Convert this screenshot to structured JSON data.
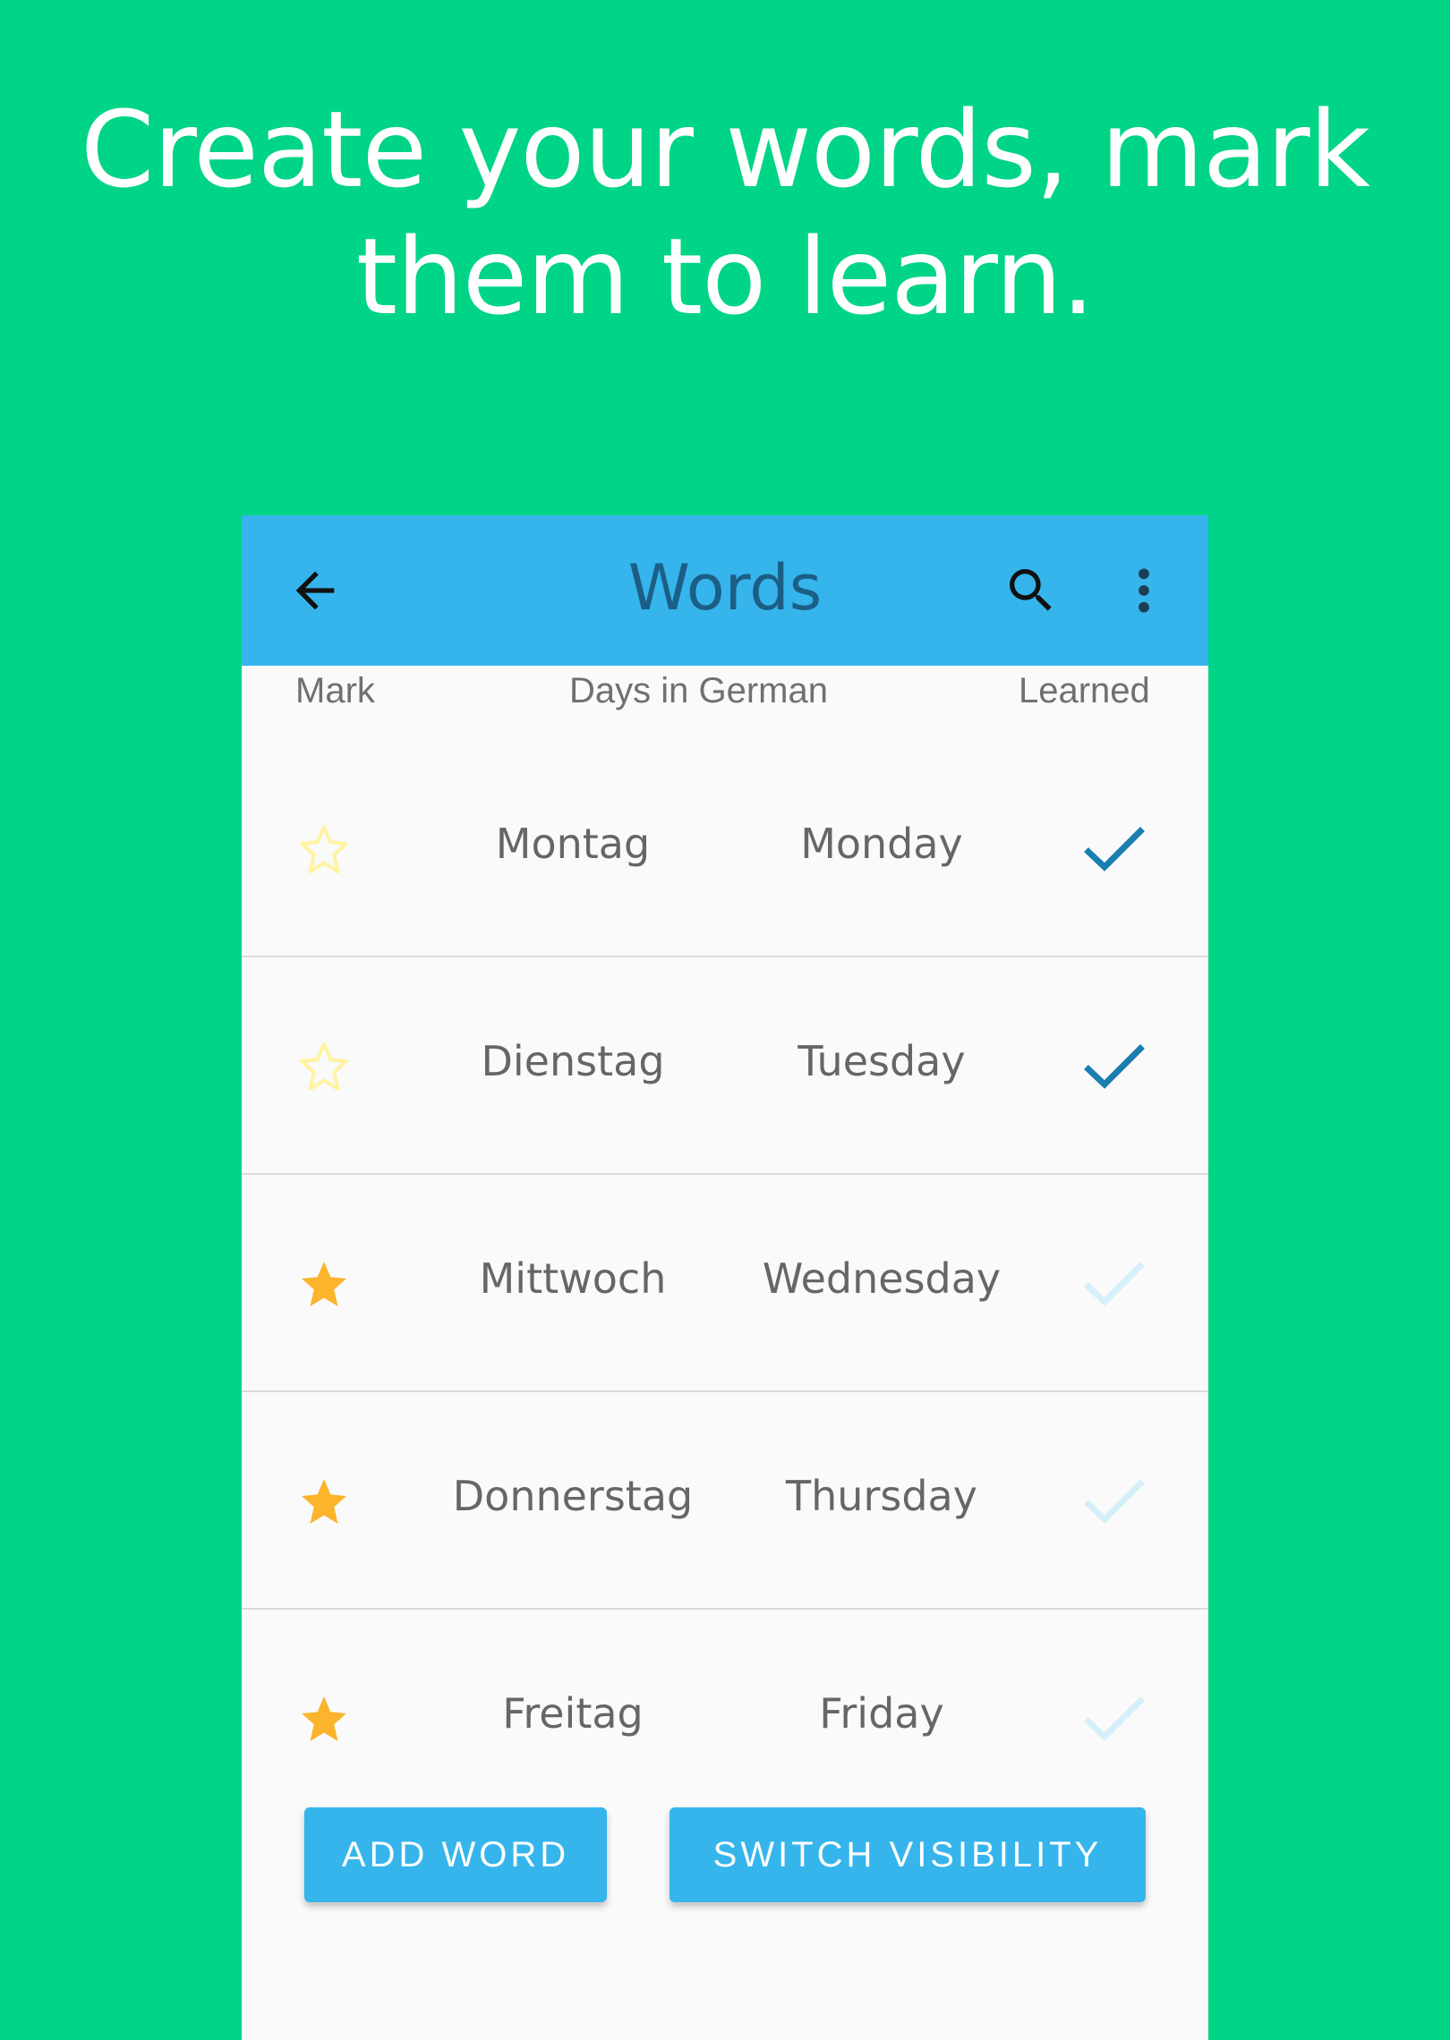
{
  "headline": {
    "line1": "Create your words, mark",
    "line2": "them to learn."
  },
  "appbar": {
    "title": "Words",
    "back_icon": "arrow-left-icon",
    "search_icon": "search-icon",
    "more_icon": "more-vertical-icon",
    "color": "#35B5EC"
  },
  "columns": {
    "mark": "Mark",
    "list_name": "Days in German",
    "learned": "Learned"
  },
  "words": [
    {
      "german": "Montag",
      "english": "Monday",
      "marked": false,
      "learned": true
    },
    {
      "german": "Dienstag",
      "english": "Tuesday",
      "marked": false,
      "learned": true
    },
    {
      "german": "Mittwoch",
      "english": "Wednesday",
      "marked": true,
      "learned": false
    },
    {
      "german": "Donnerstag",
      "english": "Thursday",
      "marked": true,
      "learned": false
    },
    {
      "german": "Freitag",
      "english": "Friday",
      "marked": true,
      "learned": false
    }
  ],
  "buttons": {
    "add_word": "ADD WORD",
    "switch_visibility": "SWITCH VISIBILITY"
  },
  "colors": {
    "background": "#00D486",
    "star_filled": "#FBB42B",
    "star_outline": "#FFF3A0",
    "check_learned": "#1A7FB0",
    "check_unlearned": "#D6F0FB"
  }
}
